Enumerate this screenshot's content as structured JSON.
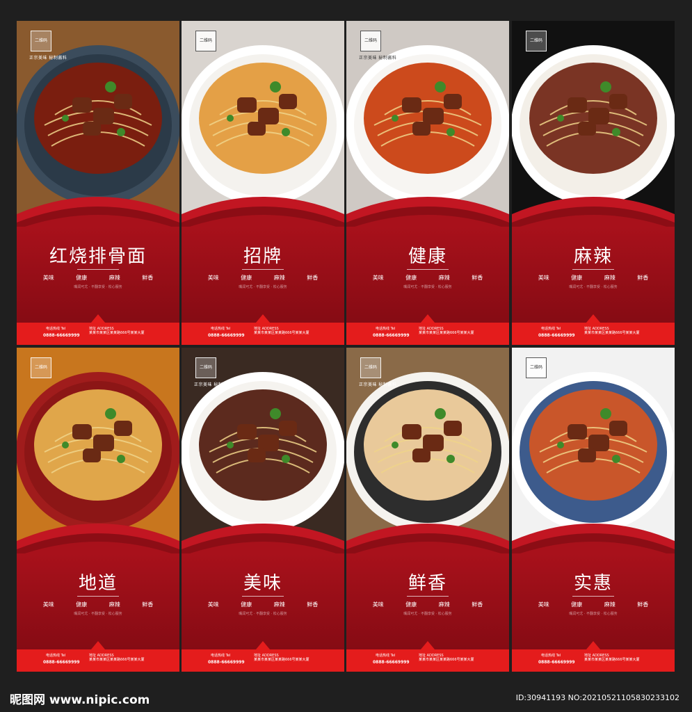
{
  "posters": [
    {
      "title": "红烧排骨面",
      "qr": "二维码",
      "slogan": "正宗美味 秘制酱料",
      "tags": [
        "美味",
        "健康",
        "麻辣",
        "鲜香"
      ],
      "desc": [
        "嘴润可尤 · 不翻享受 · 松心服务",
        "",
        "",
        ""
      ],
      "contact_label": "电话热线 Tel",
      "phone": "0888-66669999",
      "address_label": "地址 ADDRESS",
      "address": "某某市某某区某某路666号某某大厦",
      "theme": "dark"
    },
    {
      "title": "招牌",
      "qr": "二维码",
      "slogan": "",
      "tags": [
        "美味",
        "健康",
        "麻辣",
        "鲜香"
      ],
      "desc": [
        "嘴润可尤 · 不翻享受 · 松心服务",
        "",
        "",
        ""
      ],
      "contact_label": "电话热线 Tel",
      "phone": "0888-66669999",
      "address_label": "地址 ADDRESS",
      "address": "某某市某某区某某路666号某某大厦",
      "theme": "light"
    },
    {
      "title": "健康",
      "qr": "二维码",
      "slogan": "正宗美味 秘制酱料",
      "tags": [
        "美味",
        "健康",
        "麻辣",
        "鲜香"
      ],
      "desc": [
        "嘴润可尤 · 不翻享受 · 松心服务",
        "",
        "",
        ""
      ],
      "contact_label": "电话热线 Tel",
      "phone": "0888-66669999",
      "address_label": "地址 ADDRESS",
      "address": "某某市某某区某某路666号某某大厦",
      "theme": "light"
    },
    {
      "title": "麻辣",
      "qr": "二维码",
      "slogan": "",
      "tags": [
        "美味",
        "健康",
        "麻辣",
        "鲜香"
      ],
      "desc": [
        "嘴润可尤 · 不翻享受 · 松心服务",
        "",
        "",
        ""
      ],
      "contact_label": "电话热线 Tel",
      "phone": "0888-66669999",
      "address_label": "地址 ADDRESS",
      "address": "某某市某某区某某路666号某某大厦",
      "theme": "dark"
    },
    {
      "title": "地道",
      "qr": "二维码",
      "slogan": "",
      "tags": [
        "美味",
        "健康",
        "麻辣",
        "鲜香"
      ],
      "desc": [
        "嘴润可尤 · 不翻享受 · 松心服务",
        "",
        "",
        ""
      ],
      "contact_label": "电话热线 Tel",
      "phone": "0888-66669999",
      "address_label": "地址 ADDRESS",
      "address": "某某市某某区某某路666号某某大厦",
      "theme": "dark"
    },
    {
      "title": "美味",
      "qr": "二维码",
      "slogan": "正宗美味 秘制酱料",
      "tags": [
        "美味",
        "健康",
        "麻辣",
        "鲜香"
      ],
      "desc": [
        "嘴润可尤 · 不翻享受 · 松心服务",
        "",
        "",
        ""
      ],
      "contact_label": "电话热线 Tel",
      "phone": "0888-66669999",
      "address_label": "地址 ADDRESS",
      "address": "某某市某某区某某路666号某某大厦",
      "theme": "dark"
    },
    {
      "title": "鲜香",
      "qr": "二维码",
      "slogan": "正宗美味 秘制酱料",
      "tags": [
        "美味",
        "健康",
        "麻辣",
        "鲜香"
      ],
      "desc": [
        "嘴润可尤 · 不翻享受 · 松心服务",
        "",
        "",
        ""
      ],
      "contact_label": "电话热线 Tel",
      "phone": "0888-66669999",
      "address_label": "地址 ADDRESS",
      "address": "某某市某某区某某路666号某某大厦",
      "theme": "dark"
    },
    {
      "title": "实惠",
      "qr": "二维码",
      "slogan": "",
      "tags": [
        "美味",
        "健康",
        "麻辣",
        "鲜香"
      ],
      "desc": [
        "嘴润可尤 · 不翻享受 · 松心服务",
        "",
        "",
        ""
      ],
      "contact_label": "电话热线 Tel",
      "phone": "0888-66669999",
      "address_label": "地址 ADDRESS",
      "address": "某某市某某区某某路666号某某大厦",
      "theme": "light"
    }
  ],
  "footer": {
    "logo": "昵图网 www.nipic.com",
    "id": "ID:30941193 NO:20210521105830233102"
  },
  "colors": {
    "background": "#1f1f1f",
    "poster_red": "#a3101a",
    "bar_red": "#e41c1c"
  }
}
